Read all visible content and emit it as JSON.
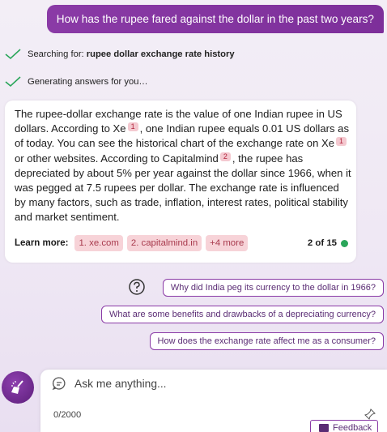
{
  "user_message": "How has the rupee fared against the dollar in the past two years?",
  "status": {
    "searching_prefix": "Searching for: ",
    "searching_query": "rupee dollar exchange rate history",
    "generating": "Generating answers for you…"
  },
  "answer": {
    "p1": "The rupee-dollar exchange rate is the value of one Indian rupee in US dollars. According to Xe",
    "c1": "1",
    "p2": ", one Indian rupee equals 0.01 US dollars as of today. You can see the historical chart of the exchange rate on Xe",
    "c2": "1",
    "p3": " or other websites. According to Capitalmind",
    "c3": "2",
    "p4": ", the rupee has depreciated by about 5% per year against the dollar since 1966, when it was pegged at 7.5 rupees per dollar. The exchange rate is influenced by many factors, such as trade, inflation, interest rates, political stability and market sentiment.",
    "learn_more_label": "Learn more:",
    "links": [
      "1. xe.com",
      "2. capitalmind.in",
      "+4 more"
    ],
    "counter": "2 of 15"
  },
  "suggestions": [
    "Why did India peg its currency to the dollar in 1966?",
    "What are some benefits and drawbacks of a depreciating currency?",
    "How does the exchange rate affect me as a consumer?"
  ],
  "composer": {
    "placeholder": "Ask me anything...",
    "char_count": "0/2000"
  },
  "feedback_label": "Feedback",
  "colors": {
    "accent": "#8a3aa6",
    "check": "#2aa65a",
    "cite_bg": "#f4c9d0"
  }
}
